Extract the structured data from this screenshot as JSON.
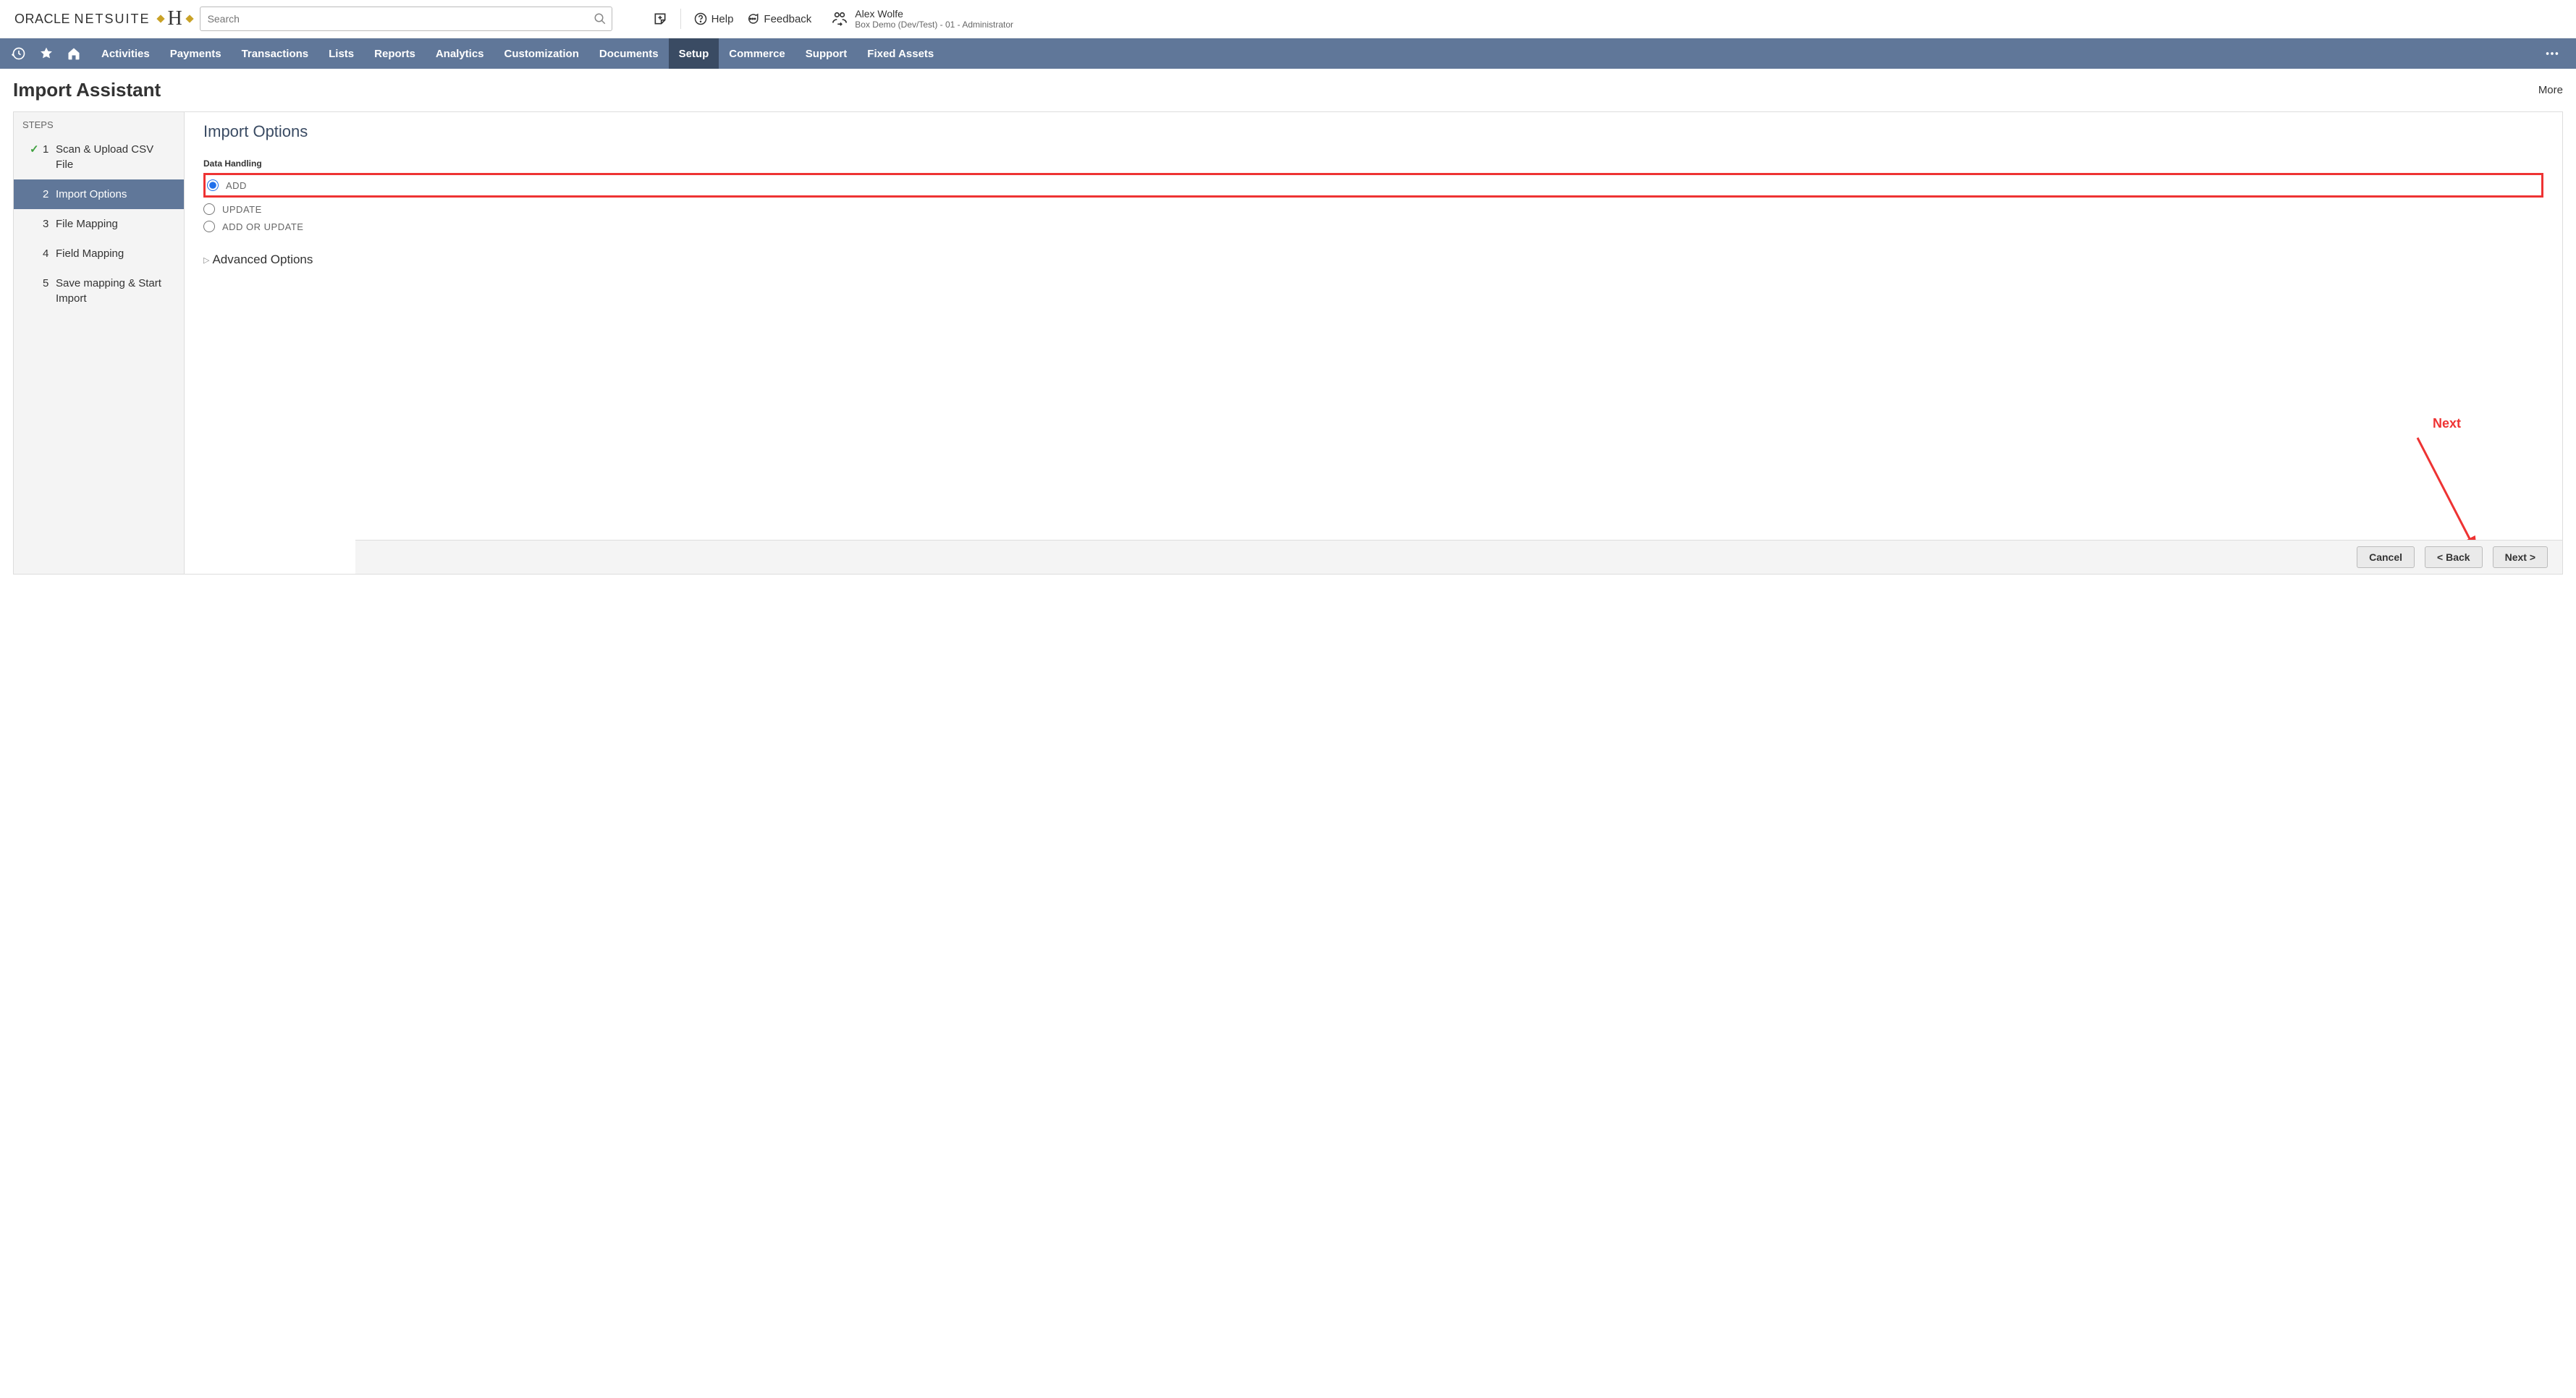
{
  "logo": {
    "oracle": "ORACLE",
    "netsuite": "NETSUITE"
  },
  "search": {
    "placeholder": "Search"
  },
  "toplinks": {
    "help": "Help",
    "feedback": "Feedback"
  },
  "user": {
    "name": "Alex Wolfe",
    "role": "Box Demo (Dev/Test) - 01  -  Administrator"
  },
  "nav": {
    "tabs": [
      "Activities",
      "Payments",
      "Transactions",
      "Lists",
      "Reports",
      "Analytics",
      "Customization",
      "Documents",
      "Setup",
      "Commerce",
      "Support",
      "Fixed Assets"
    ],
    "active_index": 8
  },
  "page": {
    "title": "Import Assistant",
    "more": "More"
  },
  "steps": {
    "header": "STEPS",
    "items": [
      {
        "num": "1",
        "label": "Scan & Upload CSV File",
        "done": true
      },
      {
        "num": "2",
        "label": "Import Options",
        "active": true
      },
      {
        "num": "3",
        "label": "File Mapping"
      },
      {
        "num": "4",
        "label": "Field Mapping"
      },
      {
        "num": "5",
        "label": "Save mapping & Start Import"
      }
    ]
  },
  "main": {
    "heading": "Import Options",
    "data_handling_label": "Data Handling",
    "options": {
      "add": "ADD",
      "update": "UPDATE",
      "add_or_update": "ADD OR UPDATE"
    },
    "advanced": "Advanced Options"
  },
  "footer": {
    "cancel": "Cancel",
    "back": "< Back",
    "next": "Next >"
  },
  "annotation": {
    "next_label": "Next"
  }
}
